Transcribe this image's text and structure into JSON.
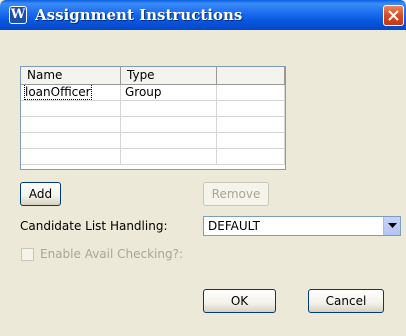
{
  "window": {
    "title": "Assignment Instructions",
    "icon": "app-logo-icon"
  },
  "table": {
    "columns": [
      "Name",
      "Type",
      ""
    ],
    "rows": [
      [
        "loanOfficer",
        "Group",
        ""
      ],
      [
        "",
        "",
        ""
      ],
      [
        "",
        "",
        ""
      ],
      [
        "",
        "",
        ""
      ],
      [
        "",
        "",
        ""
      ]
    ]
  },
  "buttons": {
    "add": "Add",
    "remove": "Remove",
    "ok": "OK",
    "cancel": "Cancel"
  },
  "candidate": {
    "label": "Candidate List Handling:",
    "value": "DEFAULT"
  },
  "avail": {
    "label": "Enable Avail Checking?:"
  },
  "colors": {
    "titlebar": "#0757e0",
    "dialog_bg": "#ece9d8",
    "close_button": "#d84a21"
  }
}
